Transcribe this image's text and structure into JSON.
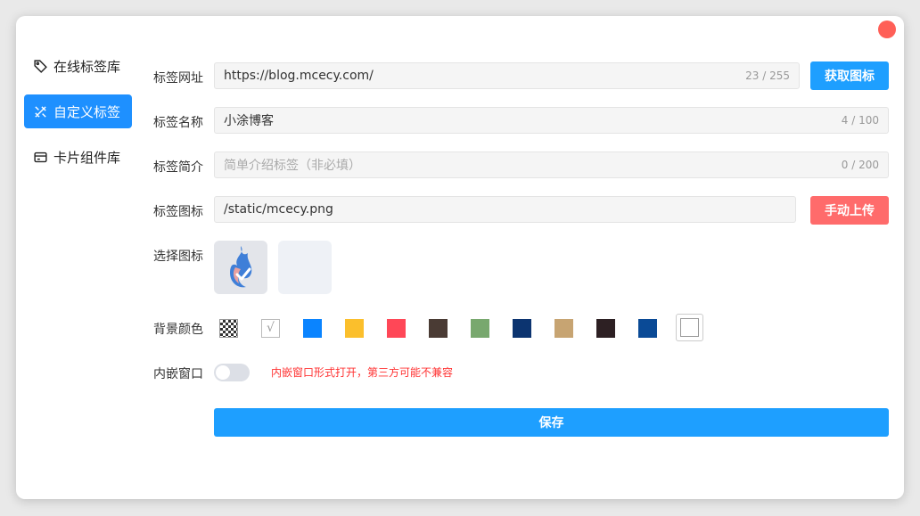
{
  "sidebar": {
    "items": [
      {
        "label": "在线标签库",
        "icon": "tag-icon",
        "active": false
      },
      {
        "label": "自定义标签",
        "icon": "tools-icon",
        "active": true
      },
      {
        "label": "卡片组件库",
        "icon": "card-icon",
        "active": false
      }
    ]
  },
  "form": {
    "url": {
      "label": "标签网址",
      "value": "https://blog.mcecy.com/",
      "count": "23 / 255",
      "button": "获取图标"
    },
    "name": {
      "label": "标签名称",
      "value": "小涂博客",
      "count": "4 / 100"
    },
    "desc": {
      "label": "标签简介",
      "placeholder": "简单介绍标签（非必填）",
      "count": "0 / 200"
    },
    "icon": {
      "label": "标签图标",
      "value": "/static/mcecy.png",
      "button": "手动上传"
    },
    "select_icon": {
      "label": "选择图标"
    },
    "bg_color": {
      "label": "背景颜色",
      "swatches": [
        "checker",
        "auto",
        "#0a84ff",
        "#fbbf2c",
        "#ff4757",
        "#4a3b34",
        "#78a86e",
        "#0c3470",
        "#c7a472",
        "#2d2023",
        "#0a4a96",
        "#ffffff"
      ]
    },
    "embed": {
      "label": "内嵌窗口",
      "enabled": false,
      "hint": "内嵌窗口形式打开，第三方可能不兼容"
    },
    "save_label": "保存"
  },
  "colors": {
    "accent": "#1e9fff",
    "danger": "#ff6b6b",
    "close": "#ff5f57"
  }
}
